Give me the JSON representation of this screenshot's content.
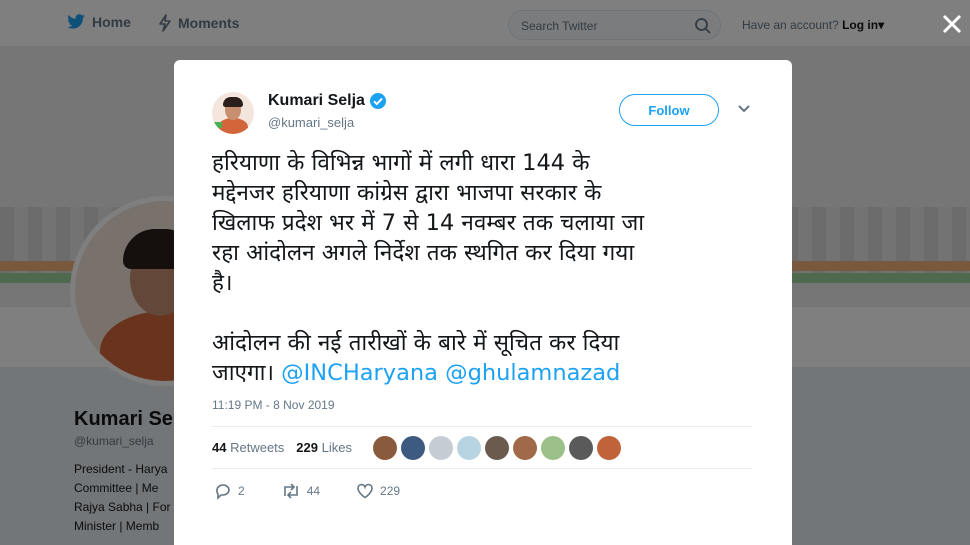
{
  "topbar": {
    "home_label": "Home",
    "moments_label": "Moments",
    "search_placeholder": "Search Twitter",
    "account_prompt": "Have an account?",
    "login_label": "Log in"
  },
  "profile": {
    "name": "Kumari Selja",
    "handle": "@kumari_selja",
    "bio_lines": [
      "President - Harya",
      "Committee | Me",
      "Rajya Sabha | For",
      "Minister | Memb"
    ]
  },
  "tweet": {
    "author_name": "Kumari Selja",
    "author_handle": "@kumari_selja",
    "verified": true,
    "follow_label": "Follow",
    "paragraph1": "हरियाणा के विभिन्न भागों में लगी धारा 144 के\nमद्देनजर हरियाणा कांग्रेस द्वारा भाजपा सरकार के\nखिलाफ प्रदेश भर में 7 से 14 नवम्बर तक चलाया जा\nरहा आंदोलन अगले निर्देश तक स्थगित कर दिया गया\nहै।",
    "paragraph2": "आंदोलन की नई तारीखों के बारे में सूचित कर दिया\nजाएगा। ",
    "mention1": "@INCHaryana",
    "mention2": "@ghulamnazad",
    "timestamp": "11:19 PM - 8 Nov 2019",
    "retweets_count": "44",
    "retweets_label": "Retweets",
    "likes_count": "229",
    "likes_label": "Likes",
    "replies": "2",
    "retweets": "44",
    "likes": "229"
  },
  "icons": {
    "bird": "twitter-bird-icon",
    "home": "home-icon",
    "moments": "lightning-icon",
    "search": "search-icon",
    "close": "close-icon",
    "verified": "verified-badge-icon",
    "reply": "reply-icon",
    "retweet": "retweet-icon",
    "like": "heart-icon",
    "caret": "chevron-down-icon"
  },
  "colors": {
    "accent": "#1da1f2",
    "text": "#14171a",
    "muted": "#657786"
  }
}
